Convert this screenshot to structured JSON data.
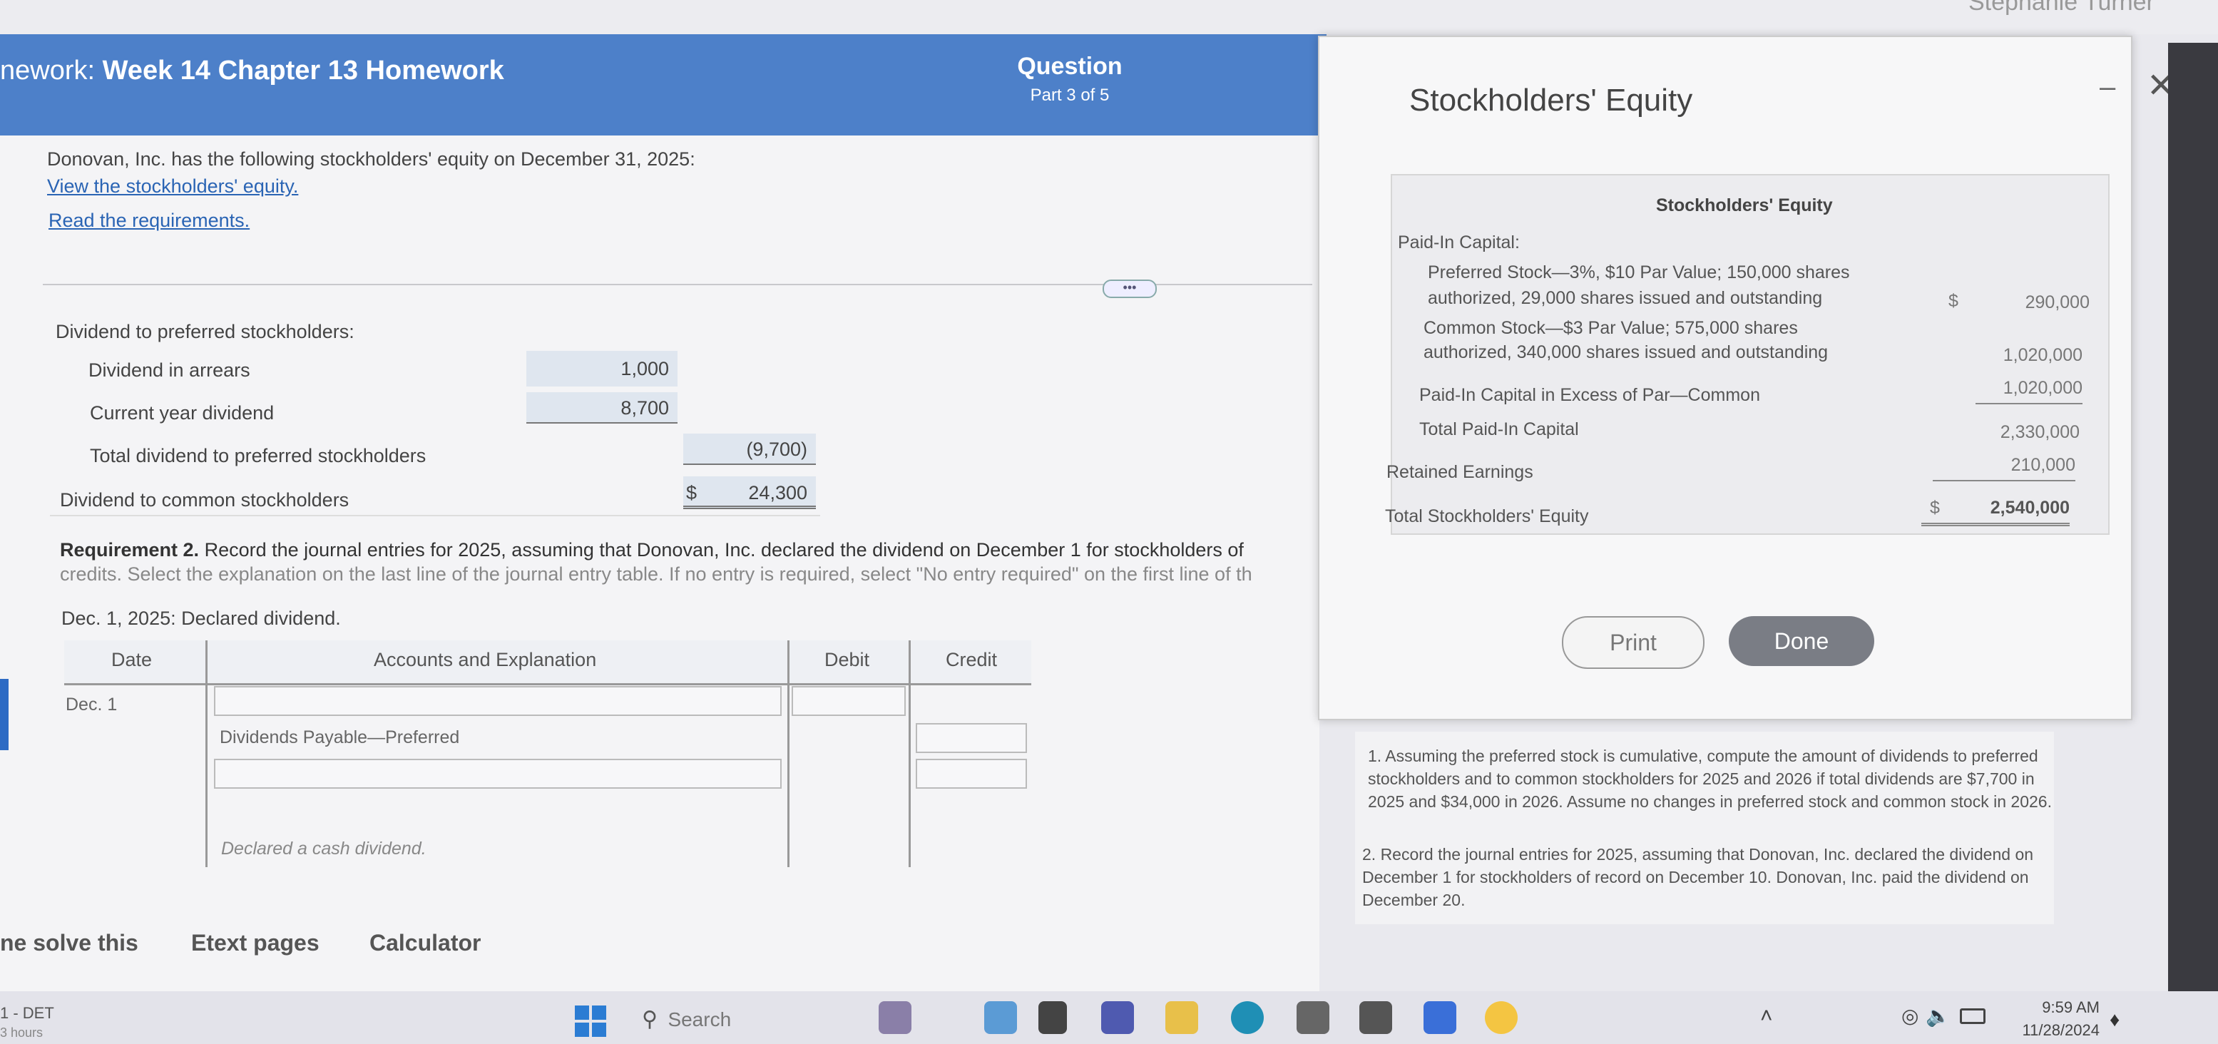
{
  "header": {
    "title_prefix": "nework:",
    "title": "Week 14 Chapter 13 Homework",
    "question_label": "Question",
    "question_part": "Part 3 of 5",
    "user_name": "Stephanie Turner"
  },
  "problem": {
    "intro": "Donovan, Inc. has the following stockholders' equity on December 31, 2025:",
    "link_equity": "View the stockholders' equity.",
    "link_requirements": "Read the requirements.",
    "ellipsis": "•••"
  },
  "dividend_calc": {
    "preferred_label": "Dividend to preferred stockholders:",
    "arrears_label": "Dividend in arrears",
    "current_label": "Current year dividend",
    "total_pref_label": "Total dividend to preferred stockholders",
    "common_label": "Dividend to common stockholders",
    "dollar": "$",
    "arrears_value": "1,000",
    "current_value": "8,700",
    "total_pref_value": "(9,700)",
    "common_value": "24,300"
  },
  "requirement2": {
    "text_line1_bold": "Requirement 2.",
    "text_line1": " Record the journal entries for 2025, assuming that Donovan, Inc. declared the dividend on December 1 for stockholders of",
    "text_line2": "credits. Select the explanation on the last line of the journal entry table. If no entry is required, select \"No entry required\" on the first line of th",
    "date_caption": "Dec. 1, 2025: Declared dividend."
  },
  "journal": {
    "headers": {
      "date": "Date",
      "accounts": "Accounts and Explanation",
      "debit": "Debit",
      "credit": "Credit"
    },
    "date": "Dec. 1",
    "row2_account": "Dividends Payable—Preferred",
    "explanation": "Declared a cash dividend."
  },
  "bottom_links": {
    "solve": "ne solve this",
    "etext": "Etext pages",
    "calculator": "Calculator"
  },
  "dialog": {
    "title": "Stockholders' Equity",
    "minimize": "–",
    "close": "✕",
    "table_title": "Stockholders' Equity",
    "paid_in_capital": "Paid-In Capital:",
    "pref_line1": "Preferred Stock—3%, $10 Par Value; 150,000 shares",
    "pref_line2": "authorized, 29,000 shares issued and outstanding",
    "pref_dollar": "$",
    "pref_value": "290,000",
    "common_line1": "Common Stock—$3 Par Value; 575,000 shares",
    "common_line2": "authorized, 340,000 shares issued and outstanding",
    "common_value": "1,020,000",
    "excess_label": "Paid-In Capital in Excess of Par—Common",
    "excess_value": "1,020,000",
    "total_paid_label": "Total Paid-In Capital",
    "total_paid_value": "2,330,000",
    "retained_label": "Retained Earnings",
    "retained_value": "210,000",
    "total_equity_label": "Total Stockholders' Equity",
    "total_dollar": "$",
    "total_equity_value": "2,540,000",
    "print_label": "Print",
    "done_label": "Done"
  },
  "requirements": {
    "item1": "1.  Assuming the preferred stock is cumulative, compute the amount of dividends to preferred stockholders and to common stockholders for 2025 and 2026 if total dividends are $7,700 in 2025 and $34,000 in 2026. Assume no changes in preferred stock and common stock in 2026.",
    "item2": "2.  Record the journal entries for 2025, assuming that Donovan, Inc. declared the dividend on December 1 for stockholders of record on December 10. Donovan, Inc. paid the dividend on December 20."
  },
  "taskbar": {
    "left_line1": "1 - DET",
    "left_line2": "3 hours",
    "search_placeholder": "Search",
    "time": "9:59 AM",
    "date": "11/28/2024"
  },
  "colors": {
    "header_blue": "#4d80c9",
    "done_gray": "#7a7d85",
    "link_blue": "#2a64b4"
  }
}
